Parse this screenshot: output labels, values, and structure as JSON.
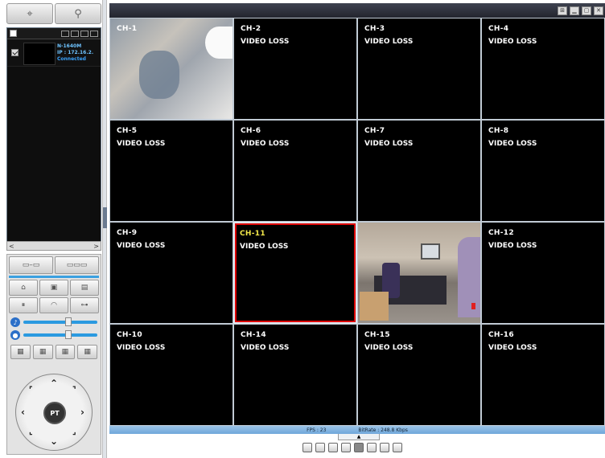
{
  "left_panel": {
    "top_buttons": [
      {
        "icon": "crosshair-icon",
        "glyph": "⌖"
      },
      {
        "icon": "search-icon",
        "glyph": "⚲"
      }
    ],
    "device": {
      "name": "N-1640M",
      "ip": "IP : 172.16.2.",
      "status": "Connected"
    },
    "scroll_left": "<",
    "scroll_right": ">",
    "ptz_center_label": "PT"
  },
  "main": {
    "channels": [
      {
        "ch": "CH-1",
        "status": ""
      },
      {
        "ch": "CH-2",
        "status": "VIDEO LOSS"
      },
      {
        "ch": "CH-3",
        "status": "VIDEO LOSS"
      },
      {
        "ch": "CH-4",
        "status": "VIDEO LOSS"
      },
      {
        "ch": "CH-5",
        "status": "VIDEO LOSS"
      },
      {
        "ch": "CH-6",
        "status": "VIDEO LOSS"
      },
      {
        "ch": "CH-7",
        "status": "VIDEO LOSS"
      },
      {
        "ch": "CH-8",
        "status": "VIDEO LOSS"
      },
      {
        "ch": "CH-9",
        "status": "VIDEO LOSS"
      },
      {
        "ch": "CH-11",
        "status": "VIDEO LOSS"
      },
      {
        "ch": "",
        "status": ""
      },
      {
        "ch": "CH-12",
        "status": "VIDEO LOSS"
      },
      {
        "ch": "CH-10",
        "status": "VIDEO LOSS"
      },
      {
        "ch": "CH-14",
        "status": "VIDEO LOSS"
      },
      {
        "ch": "CH-15",
        "status": "VIDEO LOSS"
      },
      {
        "ch": "CH-16",
        "status": "VIDEO LOSS"
      }
    ],
    "fps": "FPS : 23",
    "bitrate": "BitRate : 248.8 Kbps",
    "tab_glyph": "▲"
  },
  "colors": {
    "selected_border": "#d00000",
    "selected_label": "#f3e84a",
    "accent": "#3aa0e0"
  }
}
